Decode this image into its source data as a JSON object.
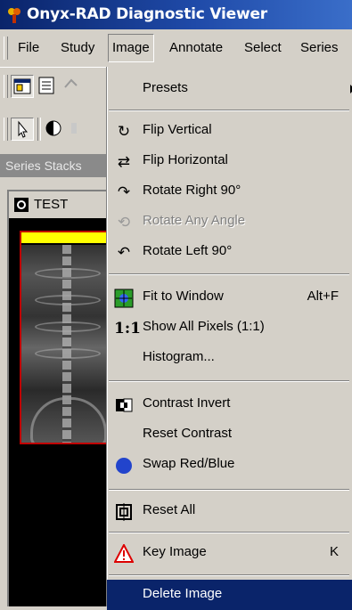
{
  "window": {
    "title": "Onyx-RAD Diagnostic Viewer"
  },
  "menubar": {
    "items": [
      "File",
      "Study",
      "Image",
      "Annotate",
      "Select",
      "Series"
    ]
  },
  "left_panel": {
    "tab": "Series Stacks",
    "series_name": "TEST"
  },
  "image_menu": {
    "items": [
      {
        "label": "Presets",
        "icon": "none",
        "submenu": true
      },
      {
        "label": "Flip Vertical",
        "icon": "flip-vertical-icon"
      },
      {
        "label": "Flip Horizontal",
        "icon": "flip-horizontal-icon"
      },
      {
        "label": "Rotate Right 90°",
        "icon": "rotate-right-icon"
      },
      {
        "label": "Rotate Any Angle",
        "icon": "rotate-any-icon",
        "disabled": true
      },
      {
        "label": "Rotate Left 90°",
        "icon": "rotate-left-icon"
      },
      {
        "label": "Fit to Window",
        "icon": "fit-window-icon",
        "shortcut": "Alt+F"
      },
      {
        "label": "Show All Pixels (1:1)",
        "icon": "one-to-one-icon"
      },
      {
        "label": "Histogram...",
        "icon": "none"
      },
      {
        "label": "Contrast Invert",
        "icon": "contrast-invert-icon"
      },
      {
        "label": "Reset Contrast",
        "icon": "none"
      },
      {
        "label": "Swap Red/Blue",
        "icon": "swap-red-blue-icon"
      },
      {
        "label": "Reset All",
        "icon": "reset-all-icon"
      },
      {
        "label": "Key Image",
        "icon": "warning-icon",
        "shortcut": "K"
      },
      {
        "label": "Delete Image",
        "icon": "none",
        "highlighted": true
      }
    ]
  },
  "colors": {
    "title_bar": "#0a246a",
    "highlight": "#0a246a",
    "thumb_border": "#c00000",
    "thumb_bar": "#ffff00"
  }
}
